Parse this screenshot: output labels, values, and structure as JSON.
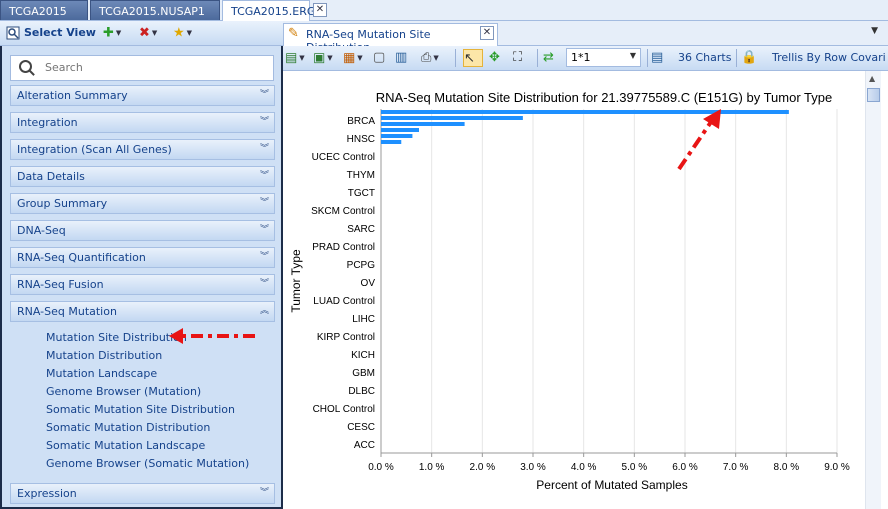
{
  "tabs": [
    {
      "label": "TCGA2015"
    },
    {
      "label": "TCGA2015.NUSAP1"
    },
    {
      "label": "TCGA2015.ERG"
    }
  ],
  "toolbar": {
    "select_view": "Select View"
  },
  "search": {
    "placeholder": "Search"
  },
  "categories": [
    {
      "label": "Alteration Summary",
      "expanded": false
    },
    {
      "label": "Integration",
      "expanded": false
    },
    {
      "label": "Integration (Scan All Genes)",
      "expanded": false
    },
    {
      "label": "Data Details",
      "expanded": false
    },
    {
      "label": "Group Summary",
      "expanded": false
    },
    {
      "label": "DNA-Seq",
      "expanded": false
    },
    {
      "label": "RNA-Seq Quantification",
      "expanded": false
    },
    {
      "label": "RNA-Seq Fusion",
      "expanded": false
    },
    {
      "label": "RNA-Seq Mutation",
      "expanded": true
    },
    {
      "label": "Expression",
      "expanded": false
    }
  ],
  "rnaseq_mutation_items": [
    "Mutation Site Distribution",
    "Mutation Distribution",
    "Mutation Landscape",
    "Genome Browser (Mutation)",
    "Somatic Mutation Site Distribution",
    "Somatic Mutation Distribution",
    "Somatic Mutation Landscape",
    "Genome Browser (Somatic Mutation)"
  ],
  "chart_panel": {
    "tab_title": "RNA-Seq Mutation Site Distribution",
    "layout_value": "1*1",
    "charts_count": "36 Charts",
    "trellis_label": "Trellis By Row Covari"
  },
  "colors": {
    "bar": "#1e90ff",
    "arrow": "#e81414",
    "header_blue": "#15428b"
  },
  "icons": [
    "select-view-icon",
    "add-star-icon",
    "remove-star-icon",
    "favorite-star-icon",
    "edit-chart-icon",
    "export-icon",
    "copy-icon",
    "paste-icon",
    "print-icon",
    "pointer-icon",
    "pan-icon",
    "zoom-fit-icon",
    "refresh-icon",
    "trellis-icon",
    "lock-icon"
  ],
  "chart_data": {
    "type": "bar",
    "orientation": "horizontal",
    "title": "RNA-Seq Mutation Site Distribution for 21.39775589.C (E151G) by Tumor Type",
    "xlabel": "Percent of Mutated Samples",
    "ylabel": "Tumor Type",
    "xlim": [
      0,
      9
    ],
    "xticks": [
      "0.0 %",
      "1.0 %",
      "2.0 %",
      "3.0 %",
      "4.0 %",
      "5.0 %",
      "6.0 %",
      "7.0 %",
      "8.0 %",
      "9.0 %"
    ],
    "grid": true,
    "categories": [
      "ACC",
      "CESC",
      "CHOL Control",
      "DLBC",
      "GBM",
      "KICH",
      "KIRP Control",
      "LIHC",
      "LUAD Control",
      "OV",
      "PCPG",
      "PRAD Control",
      "SARC",
      "SKCM Control",
      "TGCT",
      "THYM",
      "UCEC Control",
      "HNSC",
      "BRCA"
    ],
    "values": [
      0,
      0,
      0,
      0,
      0,
      0,
      0,
      0,
      0,
      0,
      0,
      0,
      0,
      0,
      0,
      0,
      0,
      0,
      0
    ],
    "top_bars": [
      8.05,
      2.8,
      1.65,
      0.75,
      0.62,
      0.4
    ]
  }
}
